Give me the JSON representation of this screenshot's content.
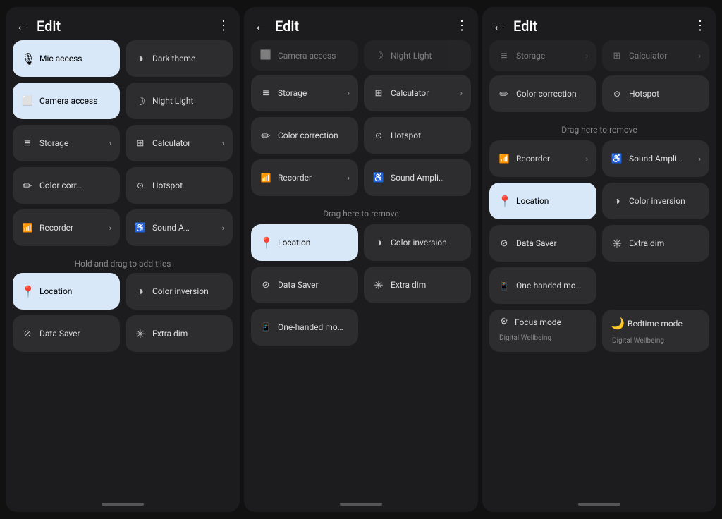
{
  "panels": [
    {
      "id": "panel1",
      "header": {
        "back": "←",
        "title": "Edit",
        "more": "⋮"
      },
      "scroll_state": "top",
      "active_tiles": [
        "mic-access",
        "camera-access",
        "location"
      ],
      "tiles_section1": [
        {
          "id": "mic-access",
          "icon": "🎙",
          "label": "Mic access",
          "active": true
        },
        {
          "id": "dark-theme",
          "icon": "◑",
          "label": "Dark theme",
          "active": false
        },
        {
          "id": "camera-access",
          "icon": "▭",
          "label": "Camera access",
          "active": true,
          "icon_type": "screen"
        },
        {
          "id": "night-light",
          "icon": "☽",
          "label": "Night Light",
          "active": false
        },
        {
          "id": "storage",
          "icon": "≡",
          "label": "Storage",
          "active": false,
          "chevron": "›"
        },
        {
          "id": "calculator",
          "icon": "⊞",
          "label": "Calculator",
          "active": false,
          "chevron": "›"
        },
        {
          "id": "color-correction",
          "icon": "✎",
          "label": "Color corr…",
          "active": false
        },
        {
          "id": "hotspot",
          "icon": "◎",
          "label": "Hotspot",
          "active": false
        },
        {
          "id": "recorder",
          "icon": "📊",
          "label": "Recorder",
          "active": false,
          "chevron": "›"
        },
        {
          "id": "sound-amp",
          "icon": "♿",
          "label": "Sound A…",
          "active": false,
          "chevron": "›"
        }
      ],
      "section_label": "Hold and drag to add tiles",
      "tiles_section2": [
        {
          "id": "location",
          "icon": "📍",
          "label": "Location",
          "active": true
        },
        {
          "id": "color-inversion",
          "icon": "◑",
          "label": "Color inversion",
          "active": false
        },
        {
          "id": "data-saver",
          "icon": "○",
          "label": "Data Saver",
          "active": false
        },
        {
          "id": "extra-dim",
          "icon": "✳",
          "label": "Extra dim",
          "active": false
        }
      ]
    },
    {
      "id": "panel2",
      "header": {
        "back": "←",
        "title": "Edit",
        "more": "⋮"
      },
      "scroll_state": "middle",
      "partial_top": [
        {
          "id": "camera-access-p2",
          "icon": "▭",
          "label": "Camera access",
          "active": false
        },
        {
          "id": "night-light-p2",
          "icon": "☽",
          "label": "Night Light",
          "active": false
        }
      ],
      "tiles_main": [
        {
          "id": "storage-p2",
          "icon": "≡",
          "label": "Storage",
          "active": false,
          "chevron": "›"
        },
        {
          "id": "calculator-p2",
          "icon": "⊞",
          "label": "Calculator",
          "active": false,
          "chevron": "›"
        },
        {
          "id": "color-correction-p2",
          "icon": "✎",
          "label": "Color correction",
          "active": false
        },
        {
          "id": "hotspot-p2",
          "icon": "◎",
          "label": "Hotspot",
          "active": false
        },
        {
          "id": "recorder-p2",
          "icon": "📊",
          "label": "Recorder",
          "active": false,
          "chevron": "›",
          "single": true
        },
        {
          "id": "sound-amp-p2",
          "icon": "♿",
          "label": "Sound Ampli…",
          "active": false,
          "single": false
        }
      ],
      "drag_label": "Drag here to remove",
      "tiles_section2": [
        {
          "id": "location-p2",
          "icon": "📍",
          "label": "Location",
          "active": true
        },
        {
          "id": "color-inversion-p2",
          "icon": "◑",
          "label": "Color inversion",
          "active": false
        },
        {
          "id": "data-saver-p2",
          "icon": "○",
          "label": "Data Saver",
          "active": false
        },
        {
          "id": "extra-dim-p2",
          "icon": "✳",
          "label": "Extra dim",
          "active": false
        },
        {
          "id": "one-handed-p2",
          "icon": "📱",
          "label": "One-handed mo…",
          "active": false
        }
      ]
    },
    {
      "id": "panel3",
      "header": {
        "back": "←",
        "title": "Edit",
        "more": "⋮"
      },
      "scroll_state": "bottom",
      "partial_top": [
        {
          "id": "storage-p3",
          "icon": "≡",
          "label": "Storage",
          "active": false,
          "chevron": "›"
        },
        {
          "id": "calculator-p3",
          "icon": "⊞",
          "label": "Calculator",
          "active": false,
          "chevron": "›"
        }
      ],
      "tiles_main": [
        {
          "id": "color-correction-p3",
          "icon": "✎",
          "label": "Color correction",
          "active": false
        },
        {
          "id": "hotspot-p3",
          "icon": "◎",
          "label": "Hotspot",
          "active": false
        }
      ],
      "drag_label": "Drag here to remove",
      "recorder_row": [
        {
          "id": "recorder-p3",
          "icon": "📊",
          "label": "Recorder",
          "active": false,
          "chevron": "›"
        },
        {
          "id": "sound-ampli-p3",
          "icon": "♿",
          "label": "Sound Ampli…",
          "active": false,
          "chevron": "›"
        }
      ],
      "tiles_section2": [
        {
          "id": "location-p3",
          "icon": "📍",
          "label": "Location",
          "active": true
        },
        {
          "id": "color-inversion-p3",
          "icon": "◑",
          "label": "Color inversion",
          "active": false
        },
        {
          "id": "data-saver-p3",
          "icon": "○",
          "label": "Data Saver",
          "active": false
        },
        {
          "id": "extra-dim-p3",
          "icon": "✳",
          "label": "Extra dim",
          "active": false
        },
        {
          "id": "one-handed-p3",
          "icon": "📱",
          "label": "One-handed mo…",
          "active": false
        }
      ],
      "tiles_section3": [
        {
          "id": "focus-mode",
          "icon": "⚙",
          "label": "Focus mode",
          "sublabel": "Digital Wellbeing",
          "active": false
        },
        {
          "id": "bedtime-mode",
          "icon": "🌙",
          "label": "Bedtime mode",
          "sublabel": "Digital Wellbeing",
          "active": false
        }
      ]
    }
  ]
}
